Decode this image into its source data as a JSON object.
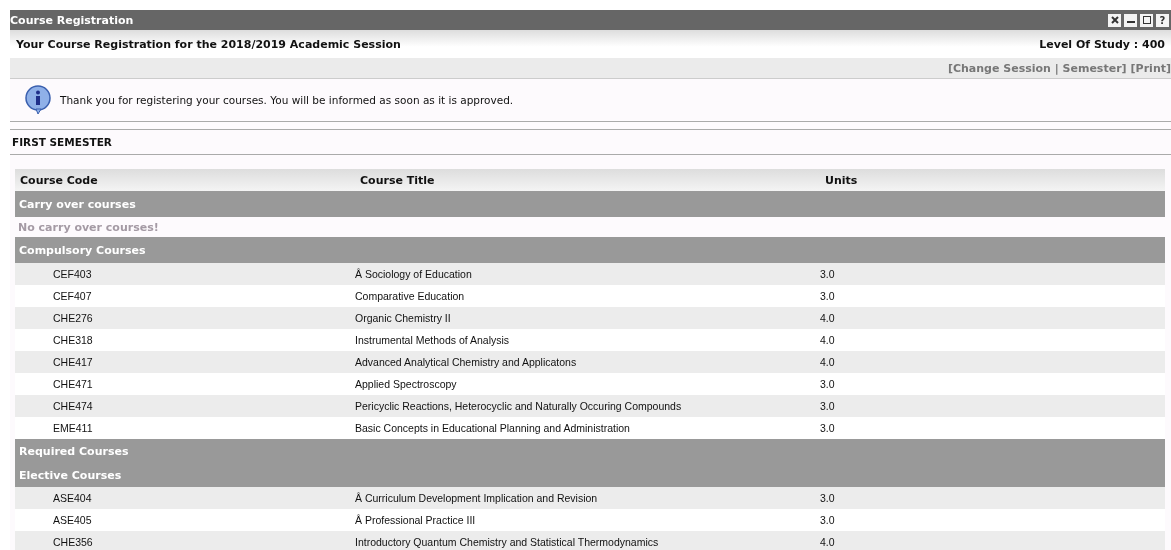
{
  "window": {
    "title": "Course Registration",
    "controls": [
      {
        "kind": "close"
      },
      {
        "kind": "minimize"
      },
      {
        "kind": "maximize"
      },
      {
        "kind": "help",
        "label": "?"
      }
    ]
  },
  "heading": {
    "title": "Your Course Registration for the 2018/2019 Academic Session",
    "level": "Level Of Study : 400"
  },
  "links": [
    "[Change Session | Semester]",
    "[Print]"
  ],
  "message": "Thank you for registering your courses. You will be informed as soon as it is approved.",
  "semester": "FIRST SEMESTER",
  "table": {
    "columns": [
      "Course Code",
      "Course Title",
      "Units"
    ],
    "rows": [
      {
        "kind": "group",
        "title": "Carry over courses"
      },
      {
        "kind": "note",
        "text": "No carry over courses!"
      },
      {
        "kind": "group",
        "title": "Compulsory Courses"
      },
      {
        "kind": "course",
        "code": "CEF403",
        "title": "Â Sociology of Education",
        "units": "3.0"
      },
      {
        "kind": "course",
        "code": "CEF407",
        "title": "Comparative Education",
        "units": "3.0"
      },
      {
        "kind": "course",
        "code": "CHE276",
        "title": "Organic Chemistry II",
        "units": "4.0"
      },
      {
        "kind": "course",
        "code": "CHE318",
        "title": "Instrumental Methods of Analysis",
        "units": "4.0"
      },
      {
        "kind": "course",
        "code": "CHE417",
        "title": "Advanced Analytical Chemistry and Applicatons",
        "units": "4.0"
      },
      {
        "kind": "course",
        "code": "CHE471",
        "title": "Applied Spectroscopy",
        "units": "3.0"
      },
      {
        "kind": "course",
        "code": "CHE474",
        "title": "Pericyclic Reactions, Heterocyclic and Naturally Occuring Compounds",
        "units": "3.0"
      },
      {
        "kind": "course",
        "code": "EME411",
        "title": "Basic Concepts in Educational Planning and Administration",
        "units": "3.0"
      },
      {
        "kind": "group",
        "title": "Required Courses"
      },
      {
        "kind": "group",
        "title": "Elective Courses"
      },
      {
        "kind": "course",
        "code": "ASE404",
        "title": "Â Curriculum Development Implication and Revision",
        "units": "3.0"
      },
      {
        "kind": "course",
        "code": "ASE405",
        "title": "Â Professional Practice III",
        "units": "3.0"
      },
      {
        "kind": "course",
        "code": "CHE356",
        "title": "Introductory Quantum Chemistry and Statistical Thermodynamics",
        "units": "4.0"
      }
    ]
  }
}
